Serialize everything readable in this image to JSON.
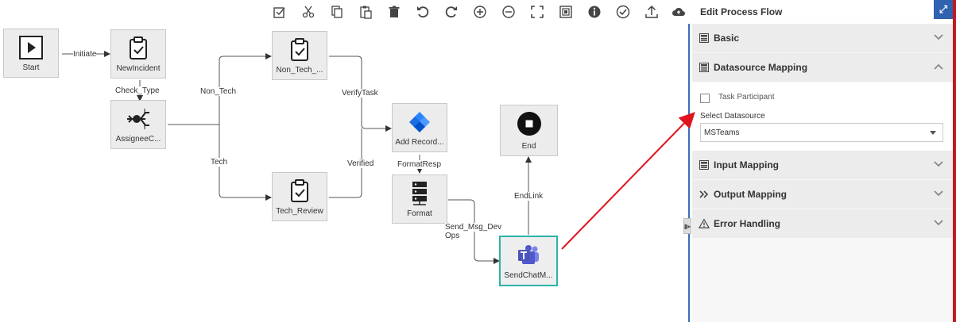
{
  "toolbar": {
    "buttons": [
      "select-all-icon",
      "cut-icon",
      "copy-icon",
      "paste-icon",
      "delete-icon",
      "undo-icon",
      "redo-icon",
      "zoom-in-icon",
      "zoom-out-icon",
      "fit-screen-icon",
      "overview-icon",
      "info-icon",
      "validate-icon",
      "upload-icon",
      "cloud-icon"
    ]
  },
  "nodes": {
    "start": "Start",
    "new_incident": "NewIncident",
    "assignee": "AssigneeC...",
    "non_tech": "Non_Tech_...",
    "tech_review": "Tech_Review",
    "add_record": "Add Record...",
    "format": "Format",
    "send_chat": "SendChatM...",
    "end": "End"
  },
  "edges": {
    "initiate": "Initiate",
    "check_type": "Check_Type",
    "non_tech": "Non_Tech",
    "tech": "Tech",
    "verify_task": "VerifyTask",
    "verified": "Verified",
    "format_resp": "FormatResp",
    "send_msg": "Send_Msg_Dev",
    "send_msg_2": "Ops",
    "end_link": "EndLink"
  },
  "panel": {
    "title": "Edit Process Flow",
    "sections": {
      "basic": "Basic",
      "datasource": "Datasource Mapping",
      "input": "Input Mapping",
      "output": "Output Mapping",
      "error": "Error Handling"
    },
    "task_participant_label": "Task Participant",
    "task_participant_checked": false,
    "select_datasource_label": "Select Datasource",
    "datasource_value": "MSTeams"
  },
  "colors": {
    "accent_blue": "#2f62b0",
    "selected_border": "#29b3a8",
    "annotation_red": "#e0141e",
    "teams_purple": "#5059c9",
    "jira_blue": "#2684ff"
  }
}
